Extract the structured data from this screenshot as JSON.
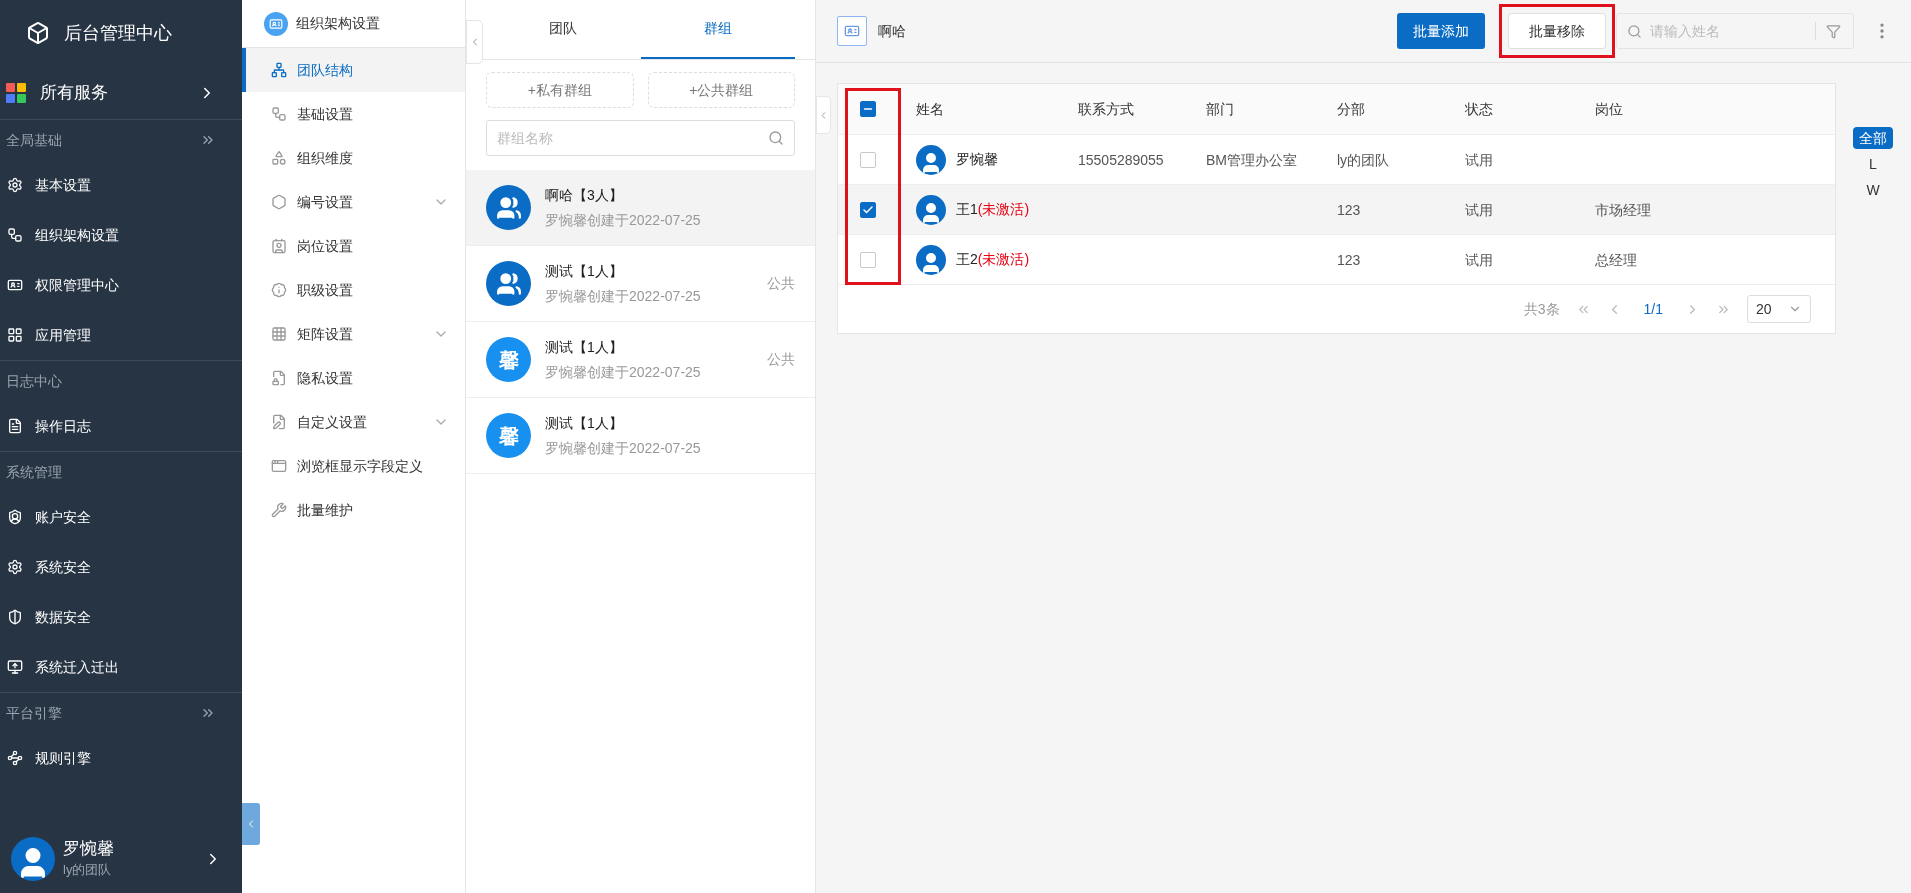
{
  "sidebar": {
    "title": "后台管理中心",
    "all_services": "所有服务",
    "sections": [
      {
        "title": "全局基础",
        "expandable": true,
        "items": [
          "基本设置",
          "组织架构设置",
          "权限管理中心",
          "应用管理"
        ]
      },
      {
        "title": "日志中心",
        "expandable": false,
        "items": [
          "操作日志"
        ]
      },
      {
        "title": "系统管理",
        "expandable": false,
        "items": [
          "账户安全",
          "系统安全",
          "数据安全",
          "系统迁入迁出"
        ]
      },
      {
        "title": "平台引擎",
        "expandable": true,
        "items": [
          "规则引擎"
        ]
      }
    ],
    "user": {
      "name": "罗惋馨",
      "team": "ly的团队"
    }
  },
  "subnav": {
    "title": "组织架构设置",
    "items": [
      {
        "label": "团队结构",
        "selected": true,
        "has_children": false
      },
      {
        "label": "基础设置",
        "selected": false,
        "has_children": false
      },
      {
        "label": "组织维度",
        "selected": false,
        "has_children": false
      },
      {
        "label": "编号设置",
        "selected": false,
        "has_children": true
      },
      {
        "label": "岗位设置",
        "selected": false,
        "has_children": false
      },
      {
        "label": "职级设置",
        "selected": false,
        "has_children": false
      },
      {
        "label": "矩阵设置",
        "selected": false,
        "has_children": true
      },
      {
        "label": "隐私设置",
        "selected": false,
        "has_children": false
      },
      {
        "label": "自定义设置",
        "selected": false,
        "has_children": true
      },
      {
        "label": "浏览框显示字段定义",
        "selected": false,
        "has_children": false
      },
      {
        "label": "批量维护",
        "selected": false,
        "has_children": false
      }
    ]
  },
  "groups_panel": {
    "tabs": [
      {
        "label": "团队",
        "selected": false
      },
      {
        "label": "群组",
        "selected": true
      }
    ],
    "buttons": [
      "+私有群组",
      "+公共群组"
    ],
    "search": {
      "placeholder": "群组名称"
    },
    "groups": [
      {
        "name": "啊哈【3人】",
        "meta": "罗惋馨创建于2022-07-25",
        "kind": "people",
        "selected": true
      },
      {
        "name": "测试【1人】",
        "meta": "罗惋馨创建于2022-07-25",
        "kind": "people",
        "tag": "公共",
        "selected": false
      },
      {
        "name": "测试【1人】",
        "meta": "罗惋馨创建于2022-07-25",
        "kind": "letter",
        "avatar_text": "馨",
        "tag": "公共",
        "selected": false
      },
      {
        "name": "测试【1人】",
        "meta": "罗惋馨创建于2022-07-25",
        "kind": "letter",
        "avatar_text": "馨",
        "selected": false
      }
    ]
  },
  "main": {
    "title": "啊哈",
    "toolbar": {
      "add_button": "批量添加",
      "remove_button": {
        "label": "批量移除",
        "highlighted": true
      },
      "search": {
        "placeholder": "请输入姓名"
      }
    },
    "table": {
      "select_all_partial": true,
      "checkbox_column_highlighted": true,
      "columns": [
        "姓名",
        "联系方式",
        "部门",
        "分部",
        "状态",
        "岗位"
      ],
      "rows": [
        {
          "checked": false,
          "name": "罗惋馨",
          "contact": "15505289055",
          "department": "BM管理办公室",
          "branch": "ly的团队",
          "status": "试用"
        },
        {
          "checked": true,
          "name": "王1",
          "inactive_tag": "(未激活)",
          "branch": "123",
          "status": "试用",
          "position": "市场经理"
        },
        {
          "checked": false,
          "name": "王2",
          "inactive_tag": "(未激活)",
          "branch": "123",
          "status": "试用",
          "position": "总经理"
        }
      ],
      "pagination": {
        "total": "共3条",
        "page": "1/1",
        "page_size": "20"
      }
    },
    "letter_index": [
      {
        "label": "全部",
        "selected": true
      },
      {
        "label": "L",
        "selected": false
      },
      {
        "label": "W",
        "selected": false
      }
    ]
  }
}
